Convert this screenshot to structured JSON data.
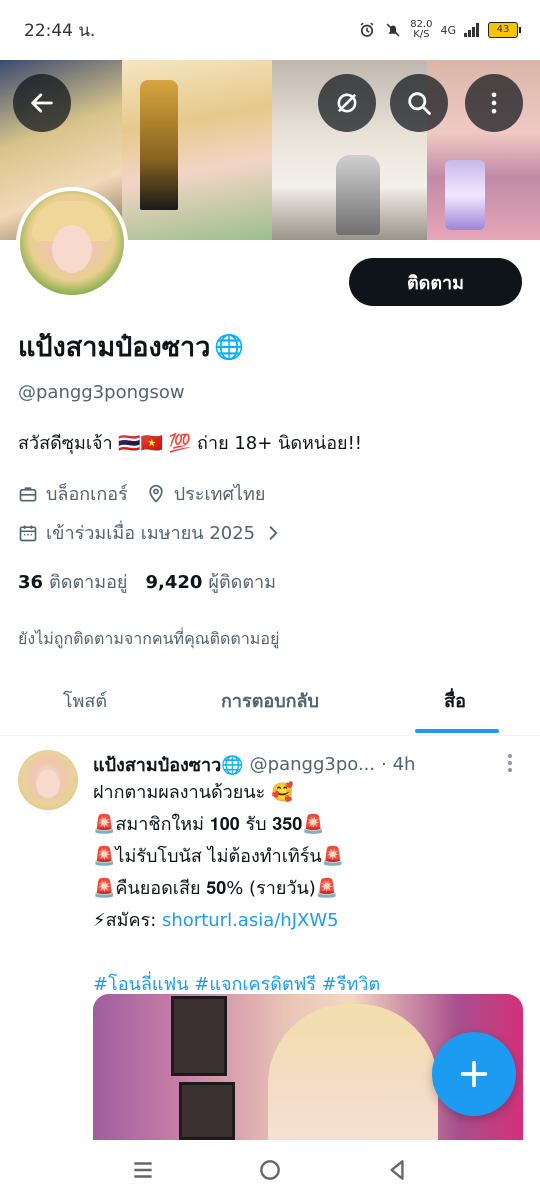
{
  "status_bar": {
    "time": "22:44 น.",
    "speed_value": "82.0",
    "speed_unit": "K/S",
    "network": "4G",
    "battery": "43"
  },
  "profile": {
    "name": "แป้งสามป๋องซาว",
    "name_emoji": "🌐",
    "handle": "@pangg3pongsow",
    "bio": "สวัสดีซุมเจ้า 🇹🇭🇻🇳 💯 ถ่าย 18+ นิดหน่อย!!",
    "category": "บล็อกเกอร์",
    "location": "ประเทศไทย",
    "joined": "เข้าร่วมเมื่อ เมษายน 2025",
    "following_count": "36",
    "following_label": "ติดตามอยู่",
    "followers_count": "9,420",
    "followers_label": "ผู้ติดตาม",
    "not_followed_note": "ยังไม่ถูกติดตามจากคนที่คุณติดตามอยู่",
    "follow_button": "ติดตาม"
  },
  "tabs": [
    {
      "label": "โพสต์",
      "active": false
    },
    {
      "label": "การตอบกลับ",
      "active": false
    },
    {
      "label": "สื่อ",
      "active": true
    }
  ],
  "post": {
    "name": "แป้งสามป๋องซาว🌐",
    "handle": "@pangg3po...",
    "time": "· 4h",
    "lines": [
      "ฝากตามผลงานด้วยนะ 🥰",
      "🚨สมาชิกใหม่ 𝟏𝟎𝟎 รับ 𝟑𝟓𝟎🚨",
      "🚨ไม่รับโบนัส ไม่ต้องทำเทิร์น🚨",
      "🚨คืนยอดเสีย 𝟓𝟎% (รายวัน)🚨"
    ],
    "signup_prefix": "⚡สมัคร: ",
    "signup_link": "shorturl.asia/hJXW5",
    "hashtags": "#โอนลี่แฟน #แจกเครดิตฟรี #รีทวิต"
  },
  "colors": {
    "accent": "#1d9bf0",
    "text_primary": "#0f1419",
    "text_secondary": "#536471",
    "follow_button_bg": "#0f1419"
  },
  "icons": [
    "back-arrow-icon",
    "mute-icon",
    "search-icon",
    "more-vertical-icon",
    "briefcase-icon",
    "location-pin-icon",
    "calendar-icon",
    "chevron-right-icon",
    "plus-icon"
  ]
}
